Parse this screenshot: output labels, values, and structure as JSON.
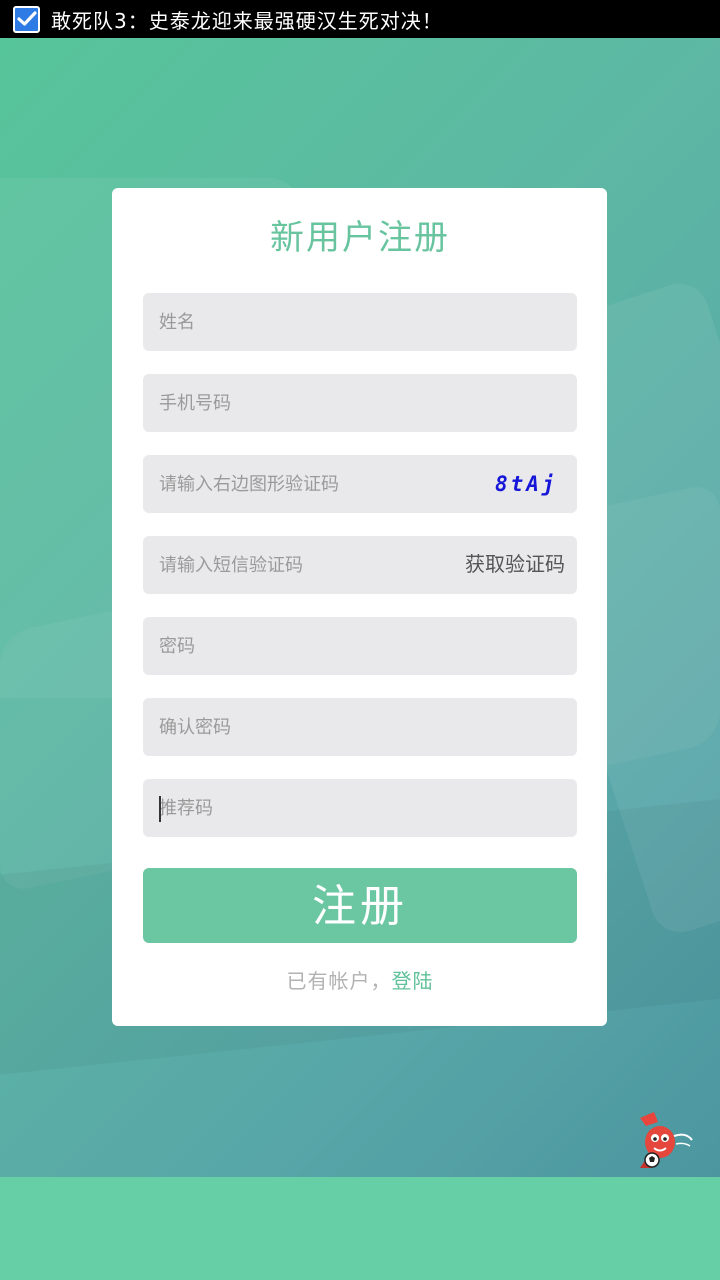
{
  "status_bar": {
    "notification_text": "敢死队3：史泰龙迎来最强硬汉生死对决！",
    "notification_icon": "checkbox-icon"
  },
  "form": {
    "title": "新用户注册",
    "name_placeholder": "姓名",
    "phone_placeholder": "手机号码",
    "image_code_placeholder": "请输入右边图形验证码",
    "captcha_text": "8tAj",
    "sms_code_placeholder": "请输入短信验证码",
    "get_sms_code_label": "获取验证码",
    "password_placeholder": "密码",
    "confirm_password_placeholder": "确认密码",
    "referral_code_placeholder": "推荐码",
    "submit_label": "注册",
    "have_account_text": "已有帐户，",
    "login_link_label": "登陆"
  },
  "colors": {
    "accent": "#67c49e",
    "captcha": "#1616d8",
    "field_bg": "#e9e9ec"
  },
  "icons": {
    "mascot": "mascot-icon"
  }
}
